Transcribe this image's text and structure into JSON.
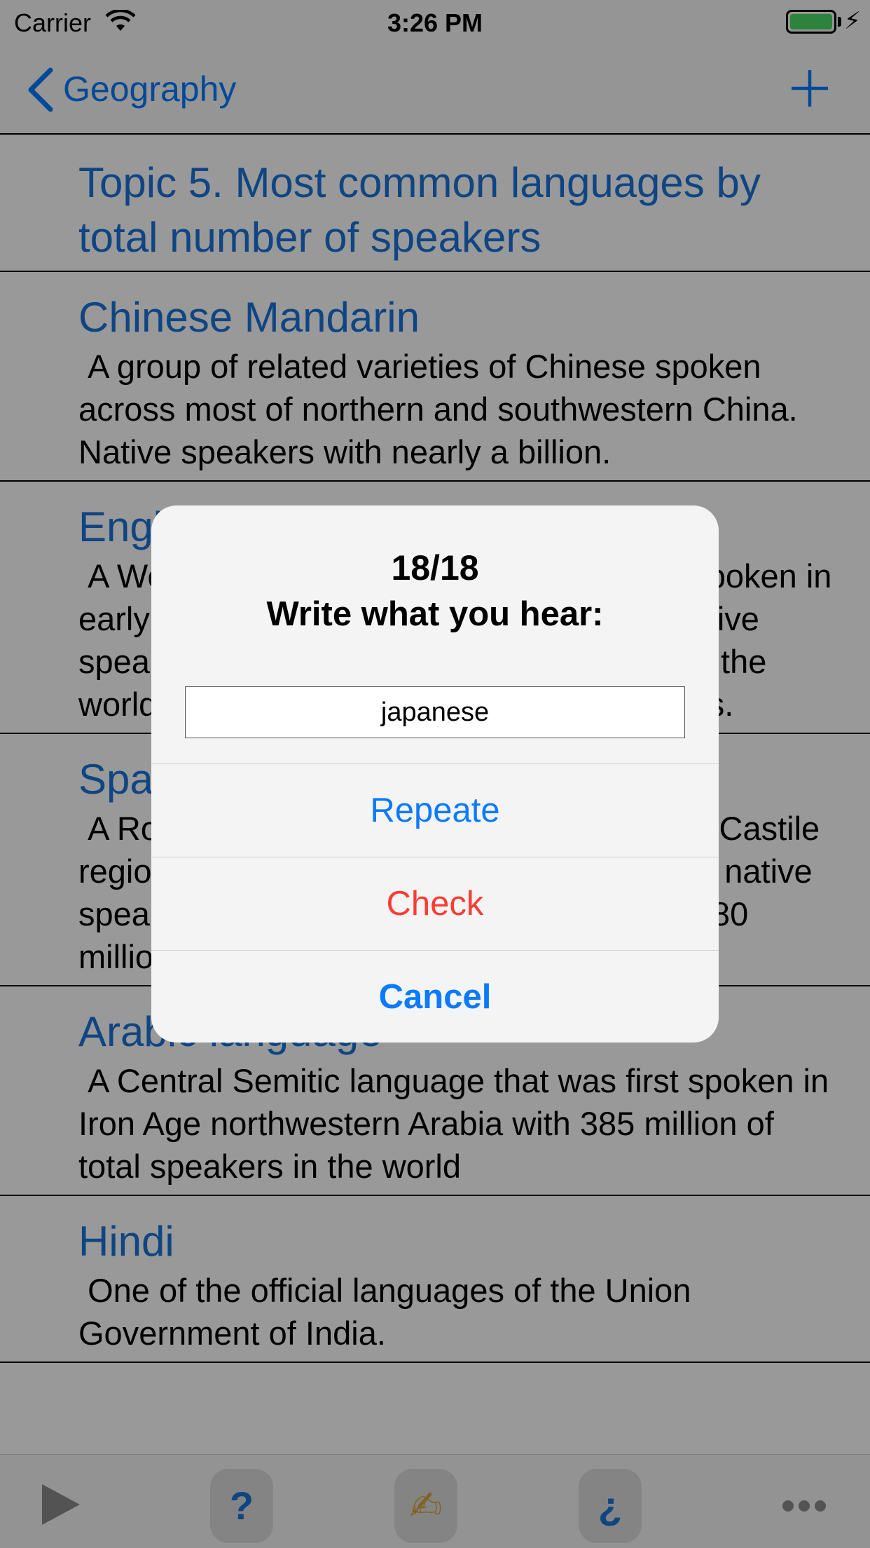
{
  "status_bar": {
    "carrier": "Carrier",
    "time": "3:26 PM"
  },
  "nav": {
    "back_label": "Geography"
  },
  "list": {
    "header": "Topic 5. Most common languages by total number of speakers",
    "items": [
      {
        "title": "Chinese Mandarin",
        "description": " A group of related varieties of Chinese spoken across most of northern and southwestern China. Native speakers with nearly a billion."
      },
      {
        "title": "English language",
        "description": " A West Germanic language that was first spoken in early medieval England. 360-400 million native speakers. It is the most spoken language in the world with about 1.132 million total speakers."
      },
      {
        "title": "Spanish language",
        "description": " A Romance language that originated in the Castile region of Spain, with hundreds of millions of native speakers across the Americas and Spain. 480 million. 570 million total speakers"
      },
      {
        "title": "Arabic language",
        "description": " A Central Semitic language that was first spoken in Iron Age northwestern Arabia with 385 million of total speakers in the world"
      },
      {
        "title": "Hindi",
        "description": " One of the official languages of the Union Government of India."
      }
    ]
  },
  "toolbar": {
    "help_label": "?",
    "write_label": "✍",
    "quiz_label": "¿"
  },
  "alert": {
    "count": "18/18",
    "message": "Write what you hear:",
    "input_value": "japanese",
    "repeat_label": "Repeate",
    "check_label": "Check",
    "cancel_label": "Cancel"
  },
  "colors": {
    "accent": "#007aff",
    "title_blue": "#1a73d9",
    "destructive": "#ff3b30",
    "battery": "#4cd964"
  }
}
